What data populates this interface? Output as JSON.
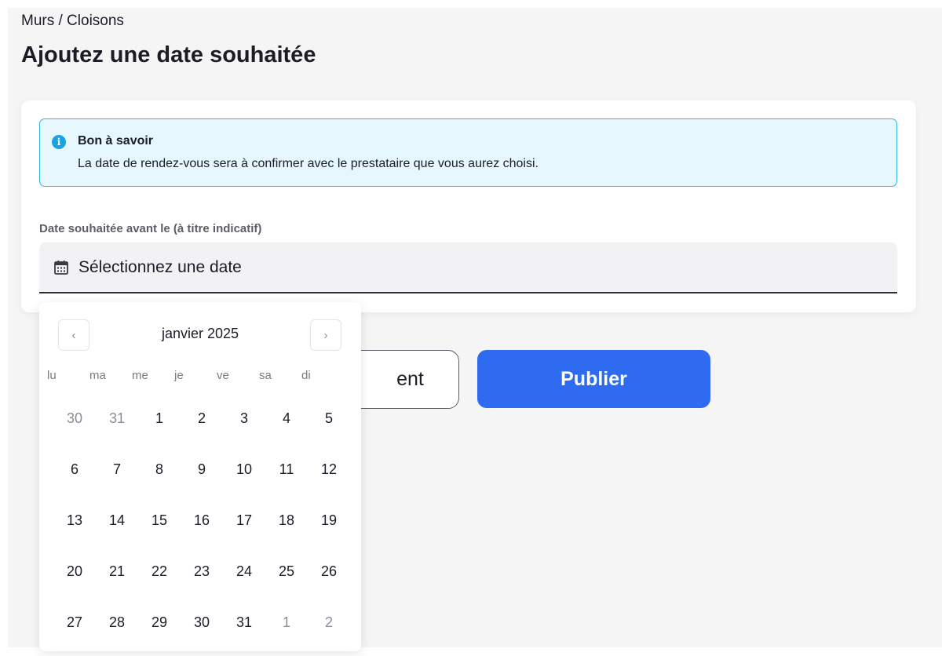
{
  "breadcrumb": "Murs / Cloisons",
  "title": "Ajoutez une date souhaitée",
  "info": {
    "icon": "info-icon",
    "title": "Bon à savoir",
    "text": "La date de rendez-vous sera à confirmer avec le prestataire que vous aurez choisi."
  },
  "date_field": {
    "label": "Date souhaitée avant le (à titre indicatif)",
    "placeholder": "Sélectionnez une date",
    "icon": "calendar-icon"
  },
  "buttons": {
    "secondary_visible_label": "ent",
    "primary_label": "Publier"
  },
  "datepicker": {
    "month_label": "janvier 2025",
    "prev_icon": "chevron-left-icon",
    "next_icon": "chevron-right-icon",
    "weekdays": [
      "lu",
      "ma",
      "me",
      "je",
      "ve",
      "sa",
      "di"
    ],
    "days": [
      {
        "label": "30",
        "muted": true
      },
      {
        "label": "31",
        "muted": true
      },
      {
        "label": "1",
        "muted": false
      },
      {
        "label": "2",
        "muted": false
      },
      {
        "label": "3",
        "muted": false
      },
      {
        "label": "4",
        "muted": false
      },
      {
        "label": "5",
        "muted": false
      },
      {
        "label": "6",
        "muted": false
      },
      {
        "label": "7",
        "muted": false
      },
      {
        "label": "8",
        "muted": false
      },
      {
        "label": "9",
        "muted": false
      },
      {
        "label": "10",
        "muted": false
      },
      {
        "label": "11",
        "muted": false
      },
      {
        "label": "12",
        "muted": false
      },
      {
        "label": "13",
        "muted": false
      },
      {
        "label": "14",
        "muted": false
      },
      {
        "label": "15",
        "muted": false
      },
      {
        "label": "16",
        "muted": false
      },
      {
        "label": "17",
        "muted": false
      },
      {
        "label": "18",
        "muted": false
      },
      {
        "label": "19",
        "muted": false
      },
      {
        "label": "20",
        "muted": false
      },
      {
        "label": "21",
        "muted": false
      },
      {
        "label": "22",
        "muted": false
      },
      {
        "label": "23",
        "muted": false
      },
      {
        "label": "24",
        "muted": false
      },
      {
        "label": "25",
        "muted": false
      },
      {
        "label": "26",
        "muted": false
      },
      {
        "label": "27",
        "muted": false
      },
      {
        "label": "28",
        "muted": false
      },
      {
        "label": "29",
        "muted": false
      },
      {
        "label": "30",
        "muted": false
      },
      {
        "label": "31",
        "muted": false
      },
      {
        "label": "1",
        "muted": true
      },
      {
        "label": "2",
        "muted": true
      }
    ]
  },
  "colors": {
    "accent": "#2f6bf0",
    "info_border": "#2fb6e8",
    "info_background": "#e6f7fd",
    "page_background": "#f5f5f6"
  }
}
